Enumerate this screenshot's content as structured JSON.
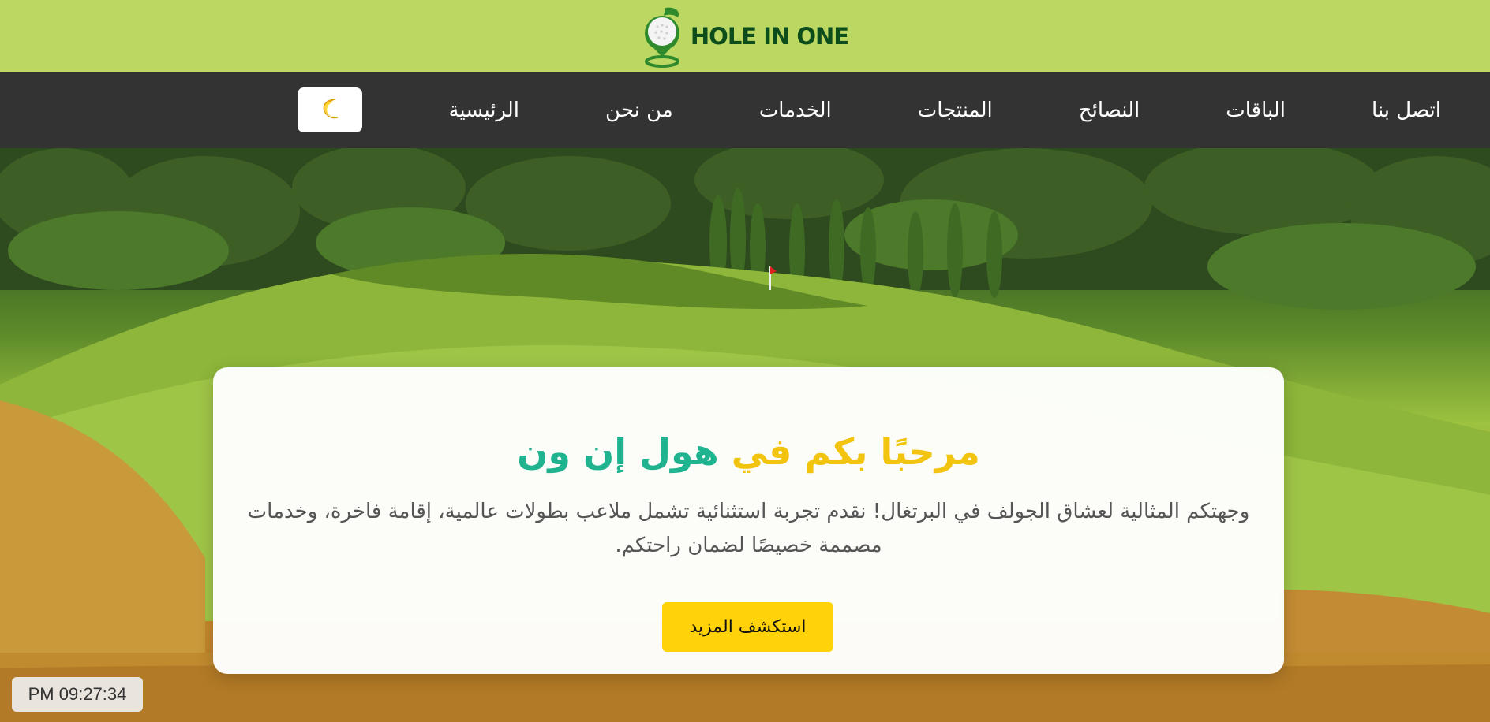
{
  "brand": {
    "logo_text": "HOLE IN ONE",
    "bar_color": "#bdd862",
    "logo_icon": "golf-ball-on-tee-icon"
  },
  "nav": {
    "items": [
      {
        "label": "اتصل بنا"
      },
      {
        "label": "الباقات"
      },
      {
        "label": "النصائح"
      },
      {
        "label": "المنتجات"
      },
      {
        "label": "الخدمات"
      },
      {
        "label": "من نحن"
      },
      {
        "label": "الرئيسية"
      }
    ],
    "theme_toggle_icon": "crescent-moon-icon",
    "background_color": "#333333"
  },
  "hero": {
    "background": "golf-course-landscape",
    "card": {
      "title_part1": "مرحبًا بكم في",
      "title_part2": "هول إن ون",
      "description": "وجهتكم المثالية لعشاق الجولف في البرتغال! نقدم تجربة استثنائية تشمل ملاعب بطولات عالمية، إقامة فاخرة، وخدمات مصممة خصيصًا لضمان راحتكم.",
      "button_label": "استكشف المزيد"
    }
  },
  "clock": {
    "time": "PM 09:27:34"
  },
  "colors": {
    "accent_yellow": "#f2c40f",
    "accent_green": "#1fb390",
    "button_yellow": "#ffd20a"
  }
}
